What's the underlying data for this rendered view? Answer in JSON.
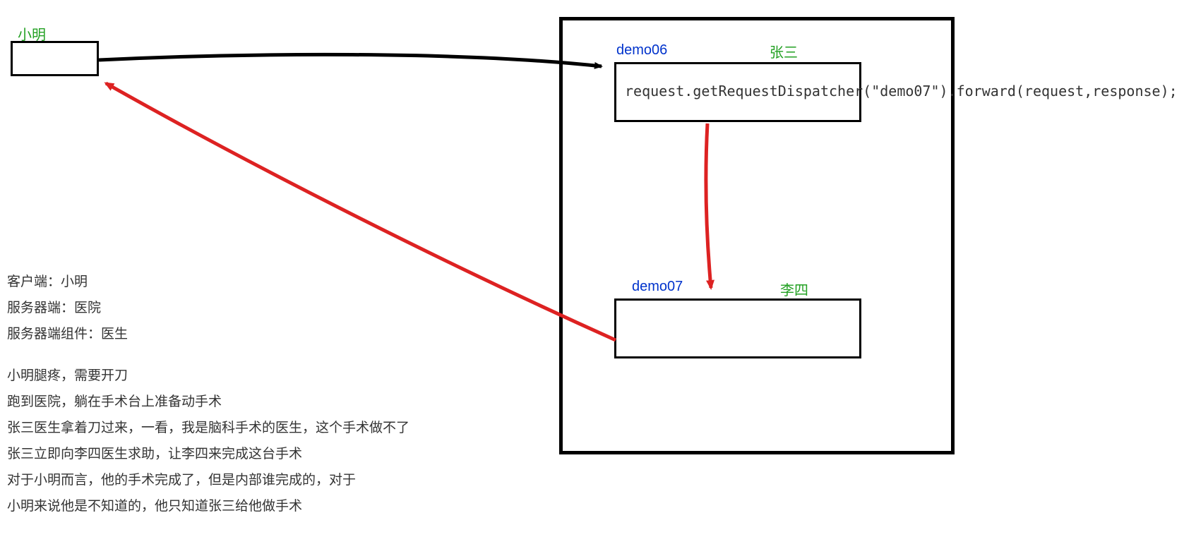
{
  "client": {
    "label": "小明"
  },
  "server": {
    "demo06": {
      "name": "demo06",
      "person": "张三"
    },
    "demo07": {
      "name": "demo07",
      "person": "李四"
    },
    "code": "request.getRequestDispatcher(\"demo07\").forward(request,response);"
  },
  "description": {
    "line1": "客户端：小明",
    "line2": "服务器端：医院",
    "line3": "服务器端组件：医生",
    "line4": "小明腿疼，需要开刀",
    "line5": "跑到医院，躺在手术台上准备动手术",
    "line6": "张三医生拿着刀过来，一看，我是脑科手术的医生，这个手术做不了",
    "line7": "张三立即向李四医生求助，让李四来完成这台手术",
    "line8": "对于小明而言，他的手术完成了，但是内部谁完成的，对于",
    "line9": "小明来说他是不知道的，他只知道张三给他做手术"
  }
}
